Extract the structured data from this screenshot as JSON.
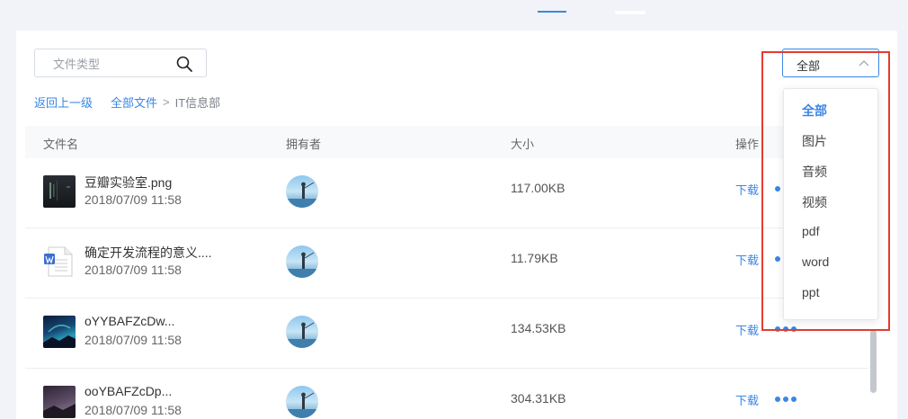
{
  "search": {
    "placeholder": "文件类型"
  },
  "breadcrumb": {
    "back": "返回上一级",
    "root": "全部文件",
    "separator": ">",
    "current": "IT信息部"
  },
  "table": {
    "headers": {
      "name": "文件名",
      "owner": "拥有者",
      "size": "大小",
      "operation": "操作"
    },
    "rows": [
      {
        "name": "豆瓣实验室.png",
        "date": "2018/07/09 11:58",
        "size": "117.00KB",
        "download": "下载",
        "thumb": "dark-screenshot-thumb"
      },
      {
        "name": "确定开发流程的意义....",
        "date": "2018/07/09 11:58",
        "size": "11.79KB",
        "download": "下载",
        "thumb": "word-doc-icon"
      },
      {
        "name": "oYYBAFZcDw...",
        "date": "2018/07/09 11:58",
        "size": "134.53KB",
        "download": "下载",
        "thumb": "aurora-image-thumb"
      },
      {
        "name": "ooYBAFZcDp...",
        "date": "2018/07/09 11:58",
        "size": "304.31KB",
        "download": "下载",
        "thumb": "night-image-thumb"
      }
    ]
  },
  "filter": {
    "selected": "全部",
    "options": [
      "全部",
      "图片",
      "音频",
      "视频",
      "pdf",
      "word",
      "ppt"
    ]
  },
  "colors": {
    "accent": "#3a86e5",
    "highlight_box": "#e43b30",
    "page_bg": "#f1f3f8"
  }
}
